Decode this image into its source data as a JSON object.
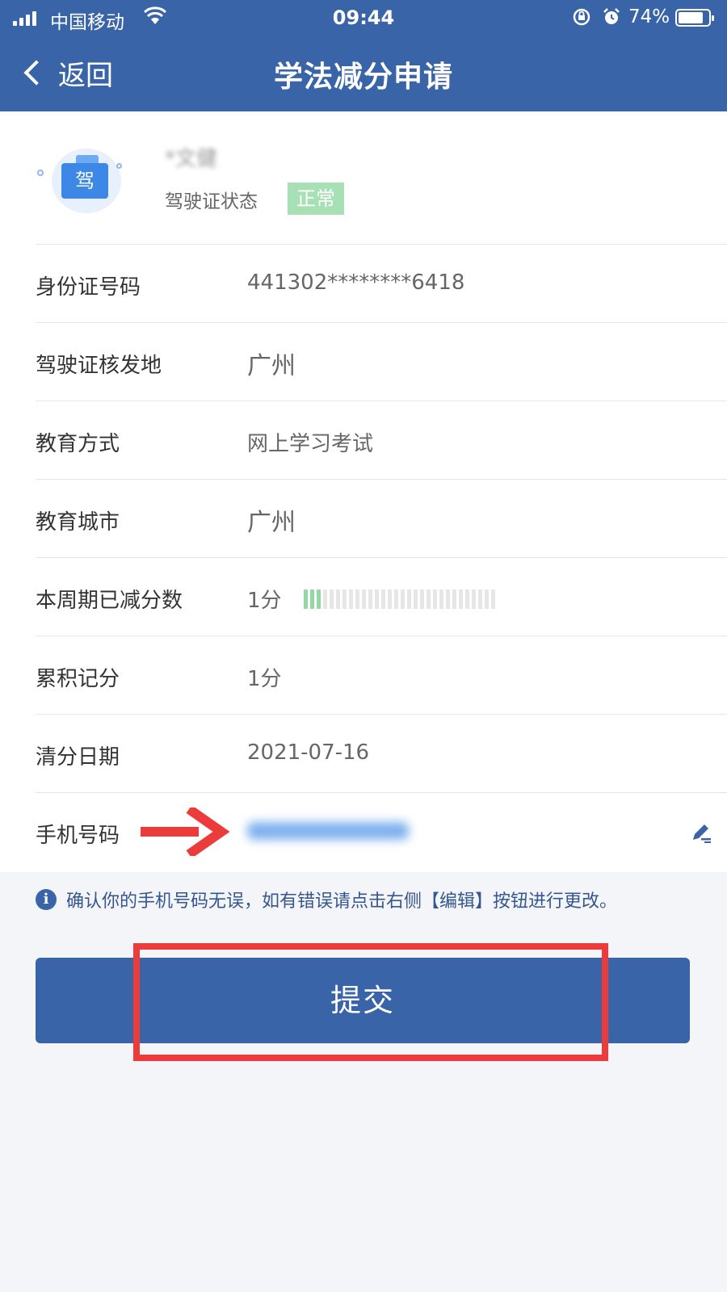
{
  "status_bar": {
    "carrier": "中国移动",
    "time": "09:44",
    "battery": "74%"
  },
  "nav": {
    "back_label": "返回",
    "title": "学法减分申请"
  },
  "profile": {
    "name": "*文健",
    "license_icon_char": "驾",
    "license_status_label": "驾驶证状态",
    "license_status": "正常"
  },
  "rows": [
    {
      "label": "身份证号码",
      "value": "441302********6418"
    },
    {
      "label": "驾驶证核发地",
      "value": "广州"
    },
    {
      "label": "教育方式",
      "value": "网上学习考试"
    },
    {
      "label": "教育城市",
      "value": "广州"
    },
    {
      "label": "本周期已减分数",
      "value": "1分",
      "meter_filled": 3,
      "meter_total": 30
    },
    {
      "label": "累积记分",
      "value": "1分"
    },
    {
      "label": "清分日期",
      "value": "2021-07-16"
    },
    {
      "label": "手机号码",
      "value": ""
    }
  ],
  "notice": "确认你的手机号码无误，如有错误请点击右侧【编辑】按钮进行更改。",
  "submit_label": "提交",
  "colors": {
    "primary": "#3a64a8",
    "status_green": "#a7e0b4",
    "highlight_red": "#ec3b3b"
  }
}
